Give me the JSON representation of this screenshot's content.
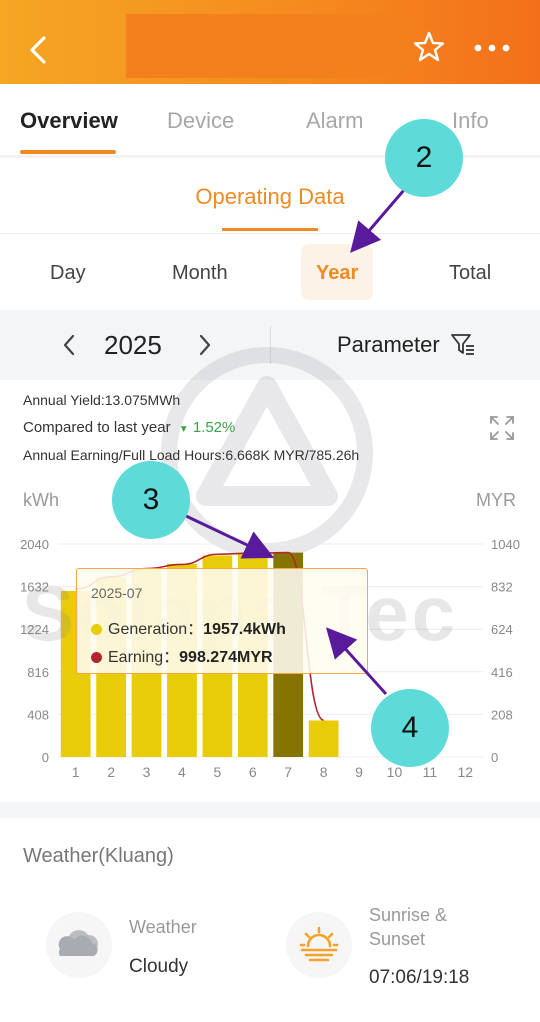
{
  "header": {
    "back_icon": "chevron-left-icon",
    "star_icon": "star-outline-icon",
    "more_icon": "more-dots-icon"
  },
  "tabs": [
    {
      "label": "Overview",
      "active": true
    },
    {
      "label": "Device",
      "active": false
    },
    {
      "label": "Alarm",
      "active": false
    },
    {
      "label": "Info",
      "active": false
    }
  ],
  "section": {
    "label": "Operating Data"
  },
  "periods": [
    {
      "label": "Day",
      "active": false
    },
    {
      "label": "Month",
      "active": false
    },
    {
      "label": "Year",
      "active": true
    },
    {
      "label": "Total",
      "active": false
    }
  ],
  "datebar": {
    "year": "2025",
    "parameter_label": "Parameter"
  },
  "stats": {
    "annual_yield": "Annual Yield:13.075MWh",
    "compared_label": "Compared to last year",
    "compared_value": "1.52%",
    "annual_earning": "Annual Earning/Full Load Hours:6.668K MYR/785.26h"
  },
  "chart_data": {
    "type": "bar",
    "left_unit": "kWh",
    "right_unit": "MYR",
    "categories": [
      "1",
      "2",
      "3",
      "4",
      "5",
      "6",
      "7",
      "8",
      "9",
      "10",
      "11",
      "12"
    ],
    "yticks_left": [
      "0",
      "408",
      "816",
      "1224",
      "1632",
      "2040"
    ],
    "yticks_right": [
      "0",
      "208",
      "416",
      "624",
      "832",
      "1040"
    ],
    "ylim": [
      0,
      2040
    ],
    "y2lim": [
      0,
      1040
    ],
    "series": [
      {
        "name": "Generation",
        "axis": "left",
        "type": "bar",
        "values": [
          1590,
          1720,
          1810,
          1850,
          1930,
          1940,
          1957.4,
          350,
          null,
          null,
          null,
          null
        ],
        "color": "#e8cc08",
        "selected_color": "#857400"
      },
      {
        "name": "Earning",
        "axis": "right",
        "type": "line",
        "values": [
          820,
          880,
          920,
          940,
          990,
          995,
          998.274,
          180,
          null,
          null,
          null,
          null
        ],
        "color": "#b3262e"
      }
    ],
    "selected_index": 6
  },
  "tooltip": {
    "date": "2025-07",
    "generation_label": "Generation：",
    "generation_value": "1957.4kWh",
    "earning_label": "Earning：",
    "earning_value": "998.274MYR"
  },
  "watermark": {
    "text": "Solapa Tec"
  },
  "annotations": [
    "2",
    "3",
    "4"
  ],
  "weather": {
    "title": "Weather(Kluang)",
    "weather_label": "Weather",
    "weather_value": "Cloudy",
    "weather_icon": "cloud-icon",
    "sun_label_1": "Sunrise &",
    "sun_label_2": "Sunset",
    "sun_value": "07:06/19:18",
    "sun_icon": "sunrise-icon"
  }
}
